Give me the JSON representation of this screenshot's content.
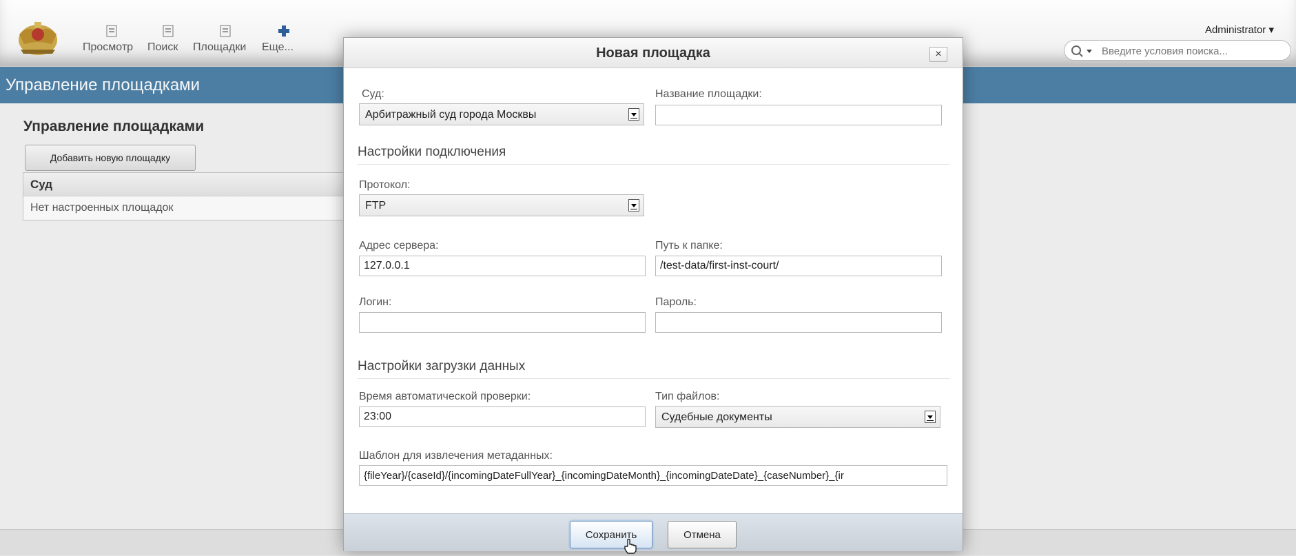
{
  "toolbar": {
    "items": [
      {
        "label": "Просмотр",
        "icon": "document-icon"
      },
      {
        "label": "Поиск",
        "icon": "document-icon"
      },
      {
        "label": "Площадки",
        "icon": "document-icon"
      },
      {
        "label": "Еще...",
        "icon": "plus-icon"
      }
    ],
    "user": "Administrator ▾",
    "search_placeholder": "Введите условия поиска..."
  },
  "section": {
    "title": "Управление площадками"
  },
  "page": {
    "title": "Управление площадками",
    "add_button": "Добавить новую площадку",
    "table": {
      "header": "Суд",
      "empty_text": "Нет настроенных площадок"
    }
  },
  "modal": {
    "title": "Новая площадка",
    "close": "×",
    "court_label": "Суд:",
    "court_value": "Арбитражный суд города Москвы",
    "name_label": "Название площадки:",
    "name_value": "",
    "connection_heading": "Настройки подключения",
    "protocol_label": "Протокол:",
    "protocol_value": "FTP",
    "server_label": "Адрес сервера:",
    "server_value": "127.0.0.1",
    "path_label": "Путь к папке:",
    "path_value": "/test-data/first-inst-court/",
    "login_label": "Логин:",
    "login_value": "",
    "password_label": "Пароль:",
    "password_value": "",
    "loading_heading": "Настройки загрузки данных",
    "time_label": "Время автоматической проверки:",
    "time_value": "23:00",
    "filetype_label": "Тип файлов:",
    "filetype_value": "Судебные документы",
    "template_label": "Шаблон для извлечения метаданных:",
    "template_value": "{fileYear}/{caseId}/{incomingDateFullYear}_{incomingDateMonth}_{incomingDateDate}_{caseNumber}_{ir",
    "save_button": "Сохранить",
    "cancel_button": "Отмена"
  },
  "colors": {
    "header_blue": "#4f83aa",
    "footer_gray": "#cfd6de"
  }
}
